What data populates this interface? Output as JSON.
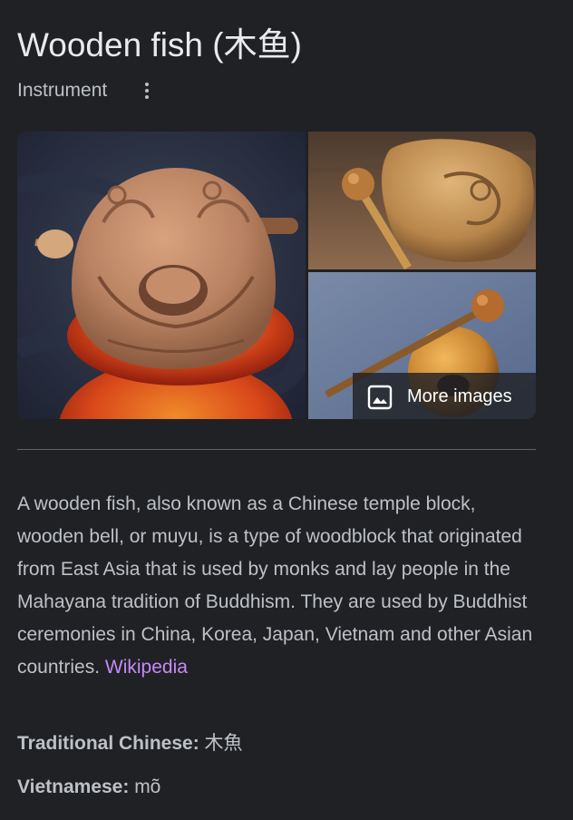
{
  "header": {
    "title": "Wooden fish (木鱼)",
    "subtitle": "Instrument",
    "menu_icon": "more-vert-icon"
  },
  "gallery": {
    "images": [
      {
        "subject": "carved wooden fish instrument on red cushion"
      },
      {
        "subject": "wooden fish with striker on wooden table"
      },
      {
        "subject": "round wooden fish with striker on blue background"
      }
    ],
    "more_images_label": "More images",
    "more_images_icon": "image-icon"
  },
  "description": {
    "text": "A wooden fish, also known as a Chinese temple block, wooden bell, or muyu, is a type of woodblock that originated from East Asia that is used by monks and lay people in the Mahayana tradition of Buddhism. They are used by Buddhist ceremonies in China, Korea, Japan, Vietnam and other Asian countries.",
    "source_link": "Wikipedia"
  },
  "facts": [
    {
      "label": "Traditional Chinese:",
      "value": "木魚"
    },
    {
      "label": "Vietnamese:",
      "value": "mõ"
    }
  ],
  "colors": {
    "background": "#202124",
    "title_text": "#e8eaed",
    "body_text": "#bdc1c6",
    "link": "#c58af9",
    "divider": "#5f6368"
  }
}
